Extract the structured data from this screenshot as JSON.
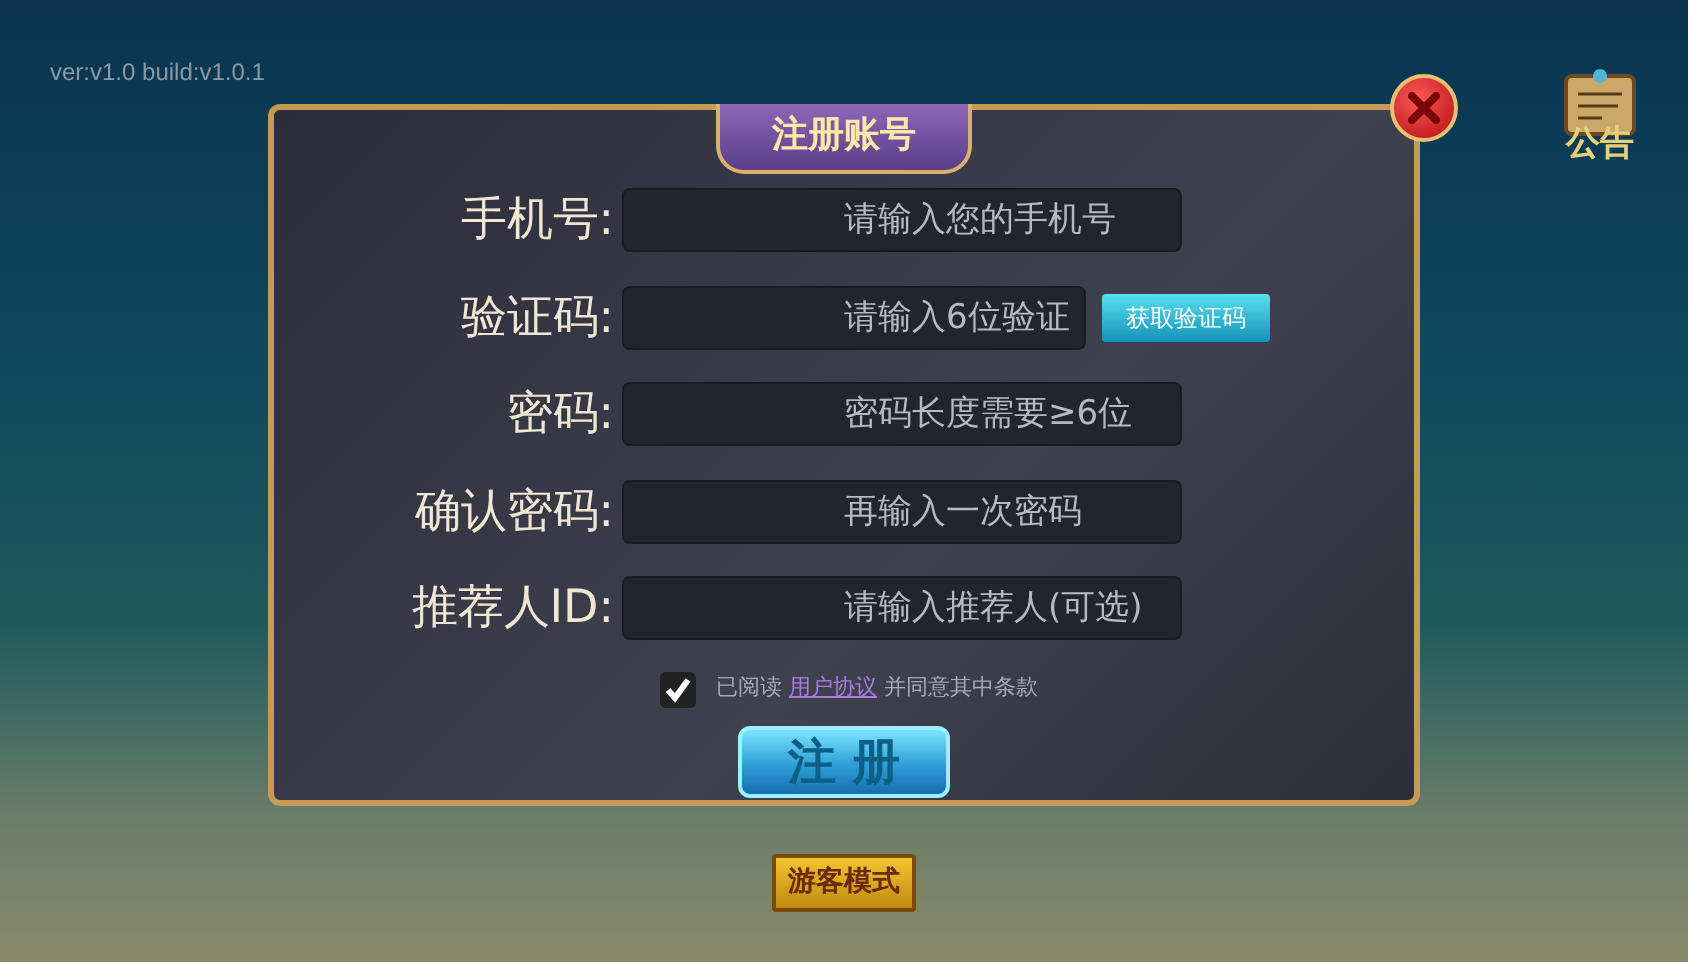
{
  "version": "ver:v1.0 build:v1.0.1",
  "notice": {
    "label": "公告"
  },
  "dialog": {
    "title": "注册账号",
    "fields": [
      {
        "label": "手机号:",
        "placeholder": "请输入您的手机号"
      },
      {
        "label": "验证码:",
        "placeholder": "请输入6位验证",
        "action": "获取验证码"
      },
      {
        "label": "密码:",
        "placeholder": "密码长度需要≥6位"
      },
      {
        "label": "确认密码:",
        "placeholder": "再输入一次密码"
      },
      {
        "label": "推荐人ID:",
        "placeholder": "请输入推荐人(可选)"
      }
    ],
    "agreement": {
      "checked": true,
      "prefix": "已阅读",
      "link": "用户协议",
      "suffix": "并同意其中条款"
    },
    "submit": "注 册"
  },
  "guest_button": "游客模式"
}
